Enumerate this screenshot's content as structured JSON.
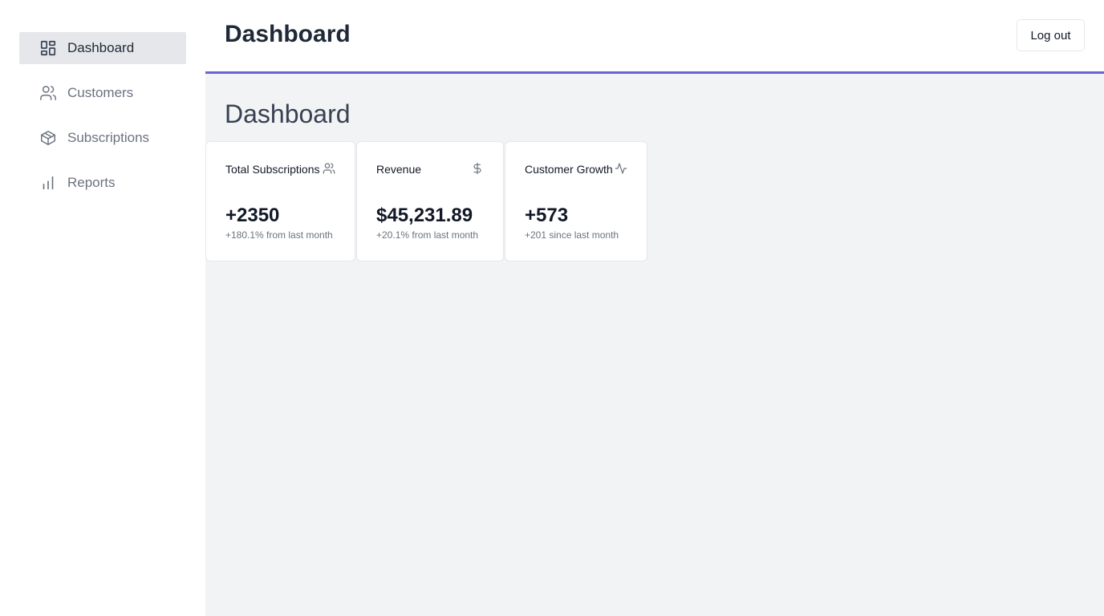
{
  "sidebar": {
    "items": [
      {
        "label": "Dashboard",
        "icon": "dashboard-icon",
        "active": true
      },
      {
        "label": "Customers",
        "icon": "users-icon",
        "active": false
      },
      {
        "label": "Subscriptions",
        "icon": "package-icon",
        "active": false
      },
      {
        "label": "Reports",
        "icon": "bar-chart-icon",
        "active": false
      }
    ]
  },
  "header": {
    "title": "Dashboard",
    "logout_label": "Log out",
    "accent_color": "#6c63d4"
  },
  "main": {
    "title": "Dashboard",
    "cards": [
      {
        "title": "Total Subscriptions",
        "icon": "users-icon",
        "value": "+2350",
        "note": "+180.1% from last month"
      },
      {
        "title": "Revenue",
        "icon": "dollar-icon",
        "value": "$45,231.89",
        "note": "+20.1% from last month"
      },
      {
        "title": "Customer Growth",
        "icon": "activity-icon",
        "value": "+573",
        "note": "+201 since last month"
      }
    ]
  }
}
